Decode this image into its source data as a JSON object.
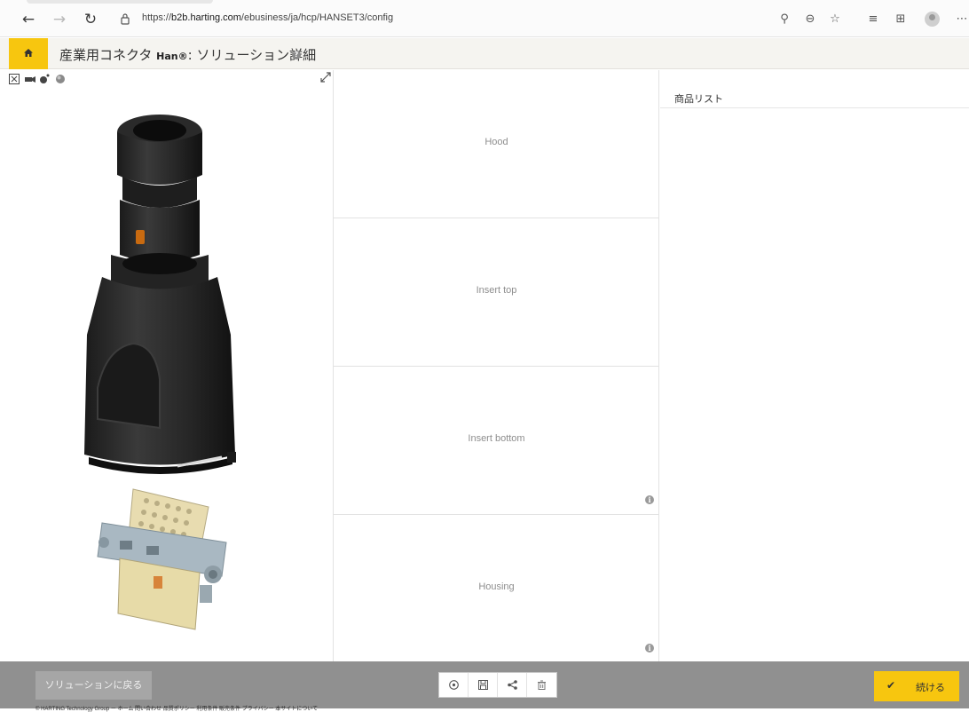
{
  "browser": {
    "url_prefix": "https://",
    "url_host": "b2b.harting.com",
    "url_path": "/ebusiness/ja/hcp/HANSET3/config",
    "icons": [
      "back-arrow-icon",
      "forward-arrow-icon",
      "refresh-icon",
      "lock-icon",
      "key-icon",
      "zoom-out-icon",
      "favorite-star-icon",
      "favorites-list-icon",
      "collections-icon",
      "profile-avatar-icon",
      "more-icon"
    ]
  },
  "header": {
    "title_prefix": "産業用コネクタ ",
    "title_product": "Han®",
    "title_suffix": ": ソリューション詳細",
    "help_glyph": "?",
    "accent_color": "#f7c60f"
  },
  "viewer": {
    "tools": [
      "fit-view-icon",
      "camera-icon",
      "exploded-view-icon",
      "material-sphere-icon"
    ],
    "expand_icon": "expand-diagonal-icon"
  },
  "slots": [
    {
      "label": "Hood",
      "has_info": false
    },
    {
      "label": "Insert top",
      "has_info": false
    },
    {
      "label": "Insert bottom",
      "has_info": true
    },
    {
      "label": "Housing",
      "has_info": true
    }
  ],
  "info_glyph": "i",
  "product_list": {
    "title": "商品リスト"
  },
  "footer": {
    "back_label": "ソリューションに戻る",
    "tools": [
      "help-circle-icon",
      "save-icon",
      "share-icon",
      "delete-icon"
    ],
    "continue_check": "✔",
    "continue_label": "続ける",
    "copyright": "© HARTING Technology Group ー ホーム 問い合わせ 品質ポリシー 利用条件 販売条件 プライバシー 本サイトについて"
  }
}
